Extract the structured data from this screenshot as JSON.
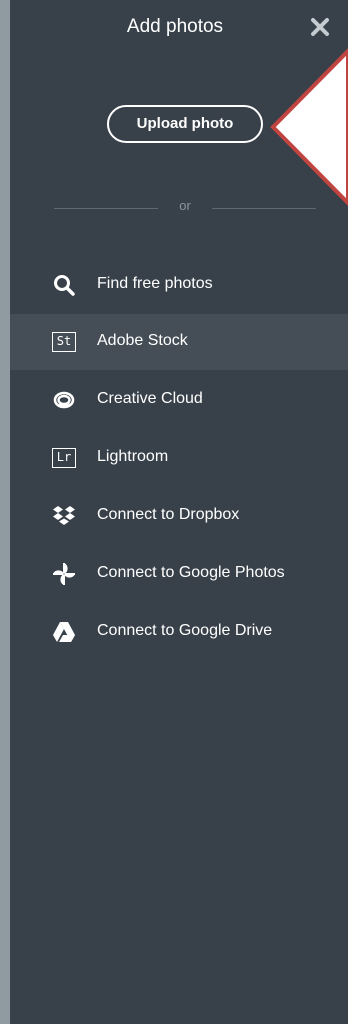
{
  "header": {
    "title": "Add photos"
  },
  "upload": {
    "label": "Upload photo"
  },
  "divider": {
    "text": "or"
  },
  "menu": [
    {
      "label": "Find free photos",
      "icon": "search-icon",
      "icon_text": "",
      "selected": false
    },
    {
      "label": "Adobe Stock",
      "icon": "adobe-stock-icon",
      "icon_text": "St",
      "selected": true
    },
    {
      "label": "Creative Cloud",
      "icon": "creative-cloud-icon",
      "icon_text": "",
      "selected": false
    },
    {
      "label": "Lightroom",
      "icon": "lightroom-icon",
      "icon_text": "Lr",
      "selected": false
    },
    {
      "label": "Connect to Dropbox",
      "icon": "dropbox-icon",
      "icon_text": "",
      "selected": false
    },
    {
      "label": "Connect to Google Photos",
      "icon": "google-photos-icon",
      "icon_text": "",
      "selected": false
    },
    {
      "label": "Connect to Google Drive",
      "icon": "google-drive-icon",
      "icon_text": "",
      "selected": false
    }
  ],
  "colors": {
    "panel_bg": "#38414a",
    "selected_row": "#454e56",
    "side_strip": "#8f9aa1",
    "annotation_arrow": "#c0443f"
  }
}
